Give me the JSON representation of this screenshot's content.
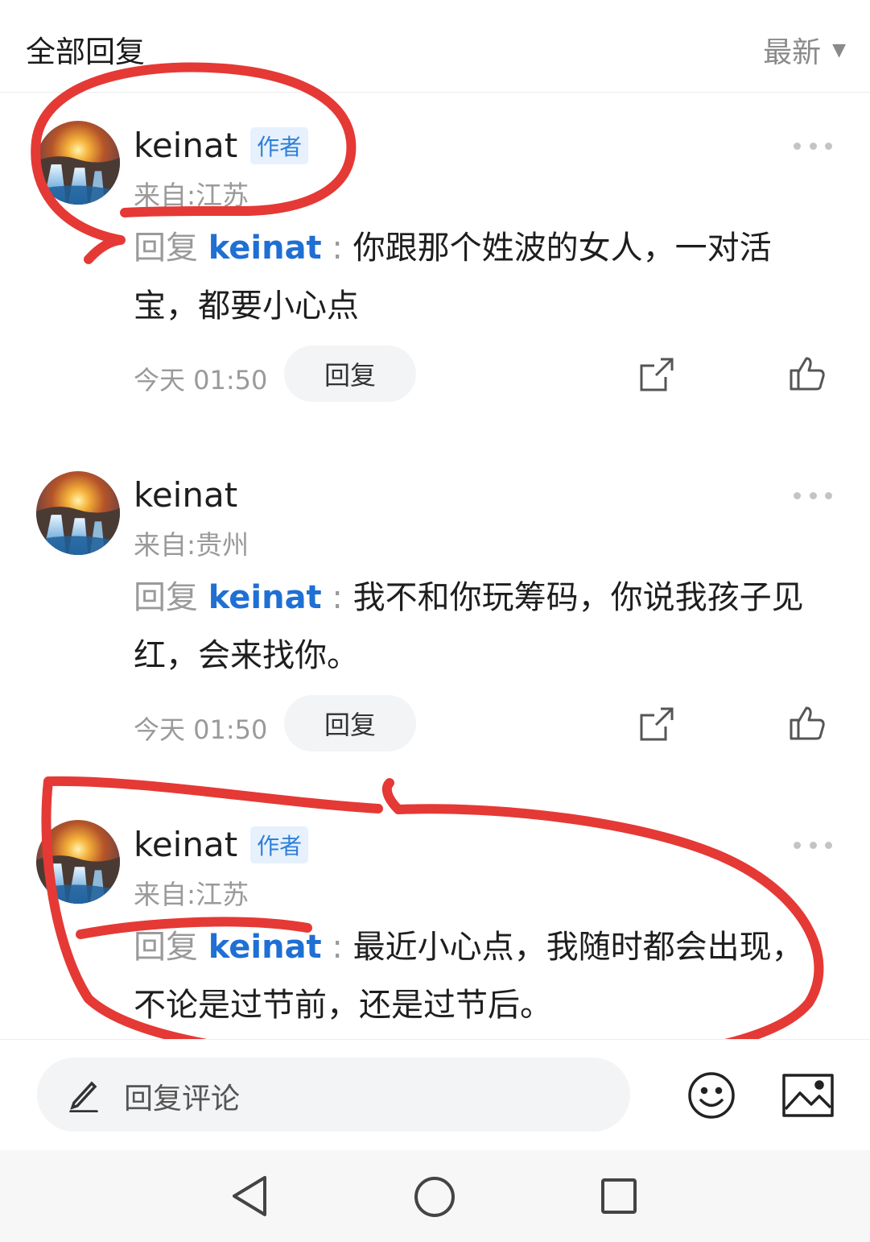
{
  "header": {
    "title": "全部回复",
    "sort_label": "最新"
  },
  "comments": [
    {
      "username": "keinat",
      "badge": "作者",
      "location": "来自:江苏",
      "reply_prefix": "回复",
      "mention": "keinat",
      "separator": " : ",
      "text": "你跟那个姓波的女人，一对活宝，都要小心点",
      "time": "今天 01:50",
      "reply_button": "回复"
    },
    {
      "username": "keinat",
      "badge": "",
      "location": "来自:贵州",
      "reply_prefix": "回复",
      "mention": "keinat",
      "separator": " : ",
      "text": "我不和你玩筹码，你说我孩子见红，会来找你。",
      "time": "今天 01:50",
      "reply_button": "回复"
    },
    {
      "username": "keinat",
      "badge": "作者",
      "location": "来自:江苏",
      "reply_prefix": "回复",
      "mention": "keinat",
      "separator": " : ",
      "text": "最近小心点，我随时都会出现，不论是过节前，还是过节后。"
    }
  ],
  "bottom_bar": {
    "input_placeholder": "回复评论"
  },
  "icons": {
    "sort": "caret-down-icon",
    "more": "more-dots-icon",
    "share": "share-icon",
    "like": "thumbs-up-icon",
    "edit": "pencil-icon",
    "emoji": "emoji-icon",
    "image": "image-icon",
    "nav": [
      "back-triangle-icon",
      "home-circle-icon",
      "recent-square-icon"
    ]
  },
  "colors": {
    "mention": "#1f6fd4",
    "badge_bg": "#e6f1fd",
    "badge_text": "#2f7fd8",
    "annotation": "#e53935"
  }
}
